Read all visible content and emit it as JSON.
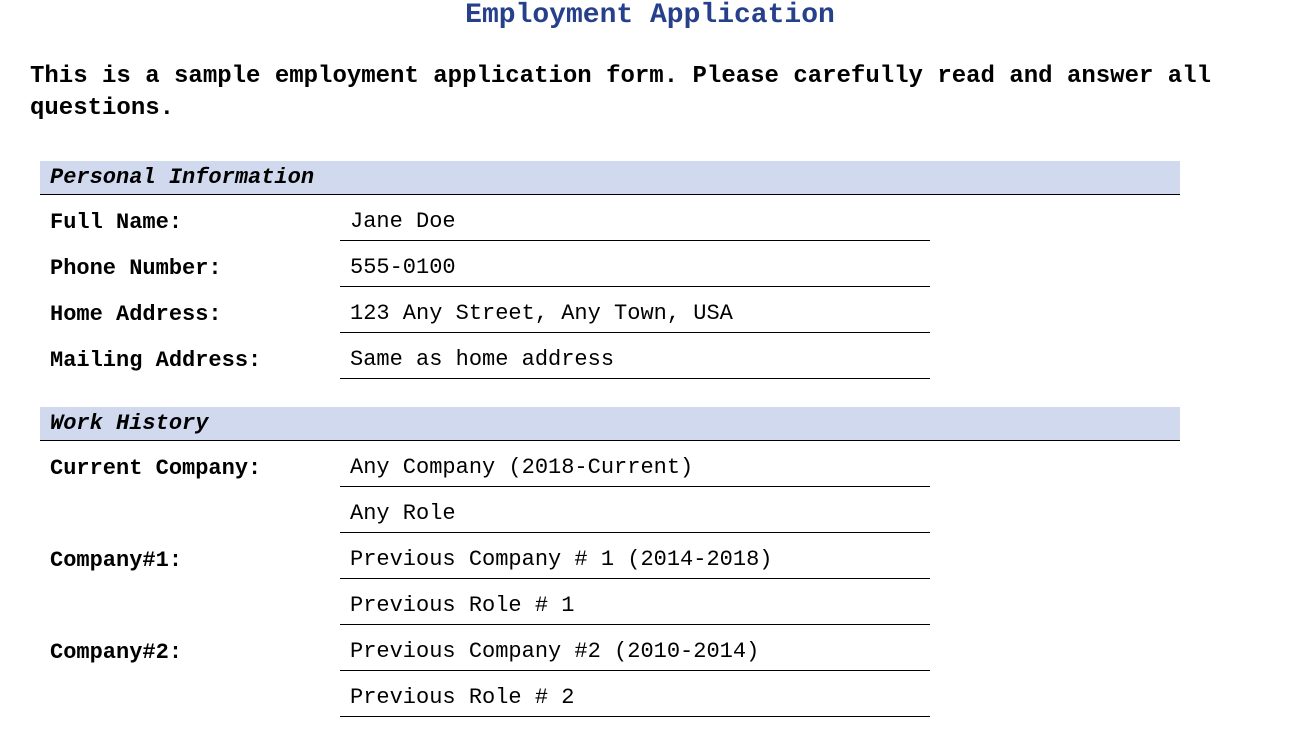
{
  "title": "Employment Application",
  "intro": "This is a sample employment application form. Please carefully read and answer all questions.",
  "sections": {
    "personal": {
      "header": "Personal Information",
      "fullNameLabel": "Full Name:",
      "fullNameValue": "Jane Doe",
      "phoneLabel": "Phone Number:",
      "phoneValue": "555-0100",
      "homeAddrLabel": "Home Address:",
      "homeAddrValue": "123 Any Street, Any Town, USA",
      "mailAddrLabel": "Mailing Address:",
      "mailAddrValue": "Same as home address"
    },
    "work": {
      "header": "Work History",
      "currentLabel": "Current Company:",
      "currentCompany": "Any Company (2018-Current)",
      "currentRole": "Any Role",
      "company1Label": "Company#1:",
      "company1Name": "Previous Company # 1 (2014-2018)",
      "company1Role": "Previous Role # 1",
      "company2Label": "Company#2:",
      "company2Name": "Previous Company #2 (2010-2014)",
      "company2Role": "Previous Role # 2"
    }
  }
}
